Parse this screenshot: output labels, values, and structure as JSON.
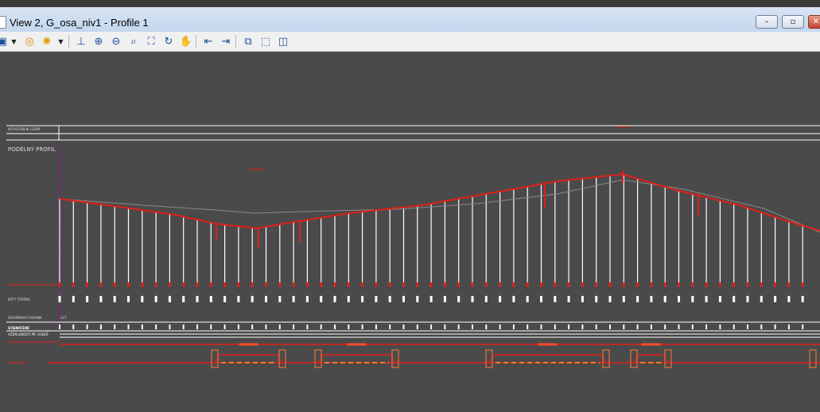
{
  "window": {
    "title": "View 2, G_osa_niv1 - Profile 1",
    "controls": {
      "minimize": "–",
      "restore": "▫",
      "close": "✕"
    }
  },
  "toolbar": {
    "icons": [
      "view-icon",
      "dropdown-arrow-icon",
      "view-attributes-icon",
      "brightness-icon",
      "dropdown-arrow-icon",
      "brush-icon",
      "zoom-in-icon",
      "zoom-out-icon",
      "zoom-area-icon",
      "fit-view-icon",
      "rotate-view-icon",
      "pan-view-icon",
      "previous-view-icon",
      "next-view-icon",
      "copy-view-icon",
      "clip-volume-icon",
      "clip-mask-icon"
    ]
  },
  "drawing": {
    "row_labels": {
      "cadastral": "KATASTRÁLNÍ ÚZEMÍ",
      "profile": "PODÉLNÝ PROFIL",
      "terrain_heights": "KÓTY TERÉNU",
      "datum": "SROVNÁVACÍ ROVINA",
      "datum_value": "227",
      "stationing": "STANIČENÍ",
      "distances": "VZDÁLENOSTI PŘ. ÚSEKŮ"
    },
    "colors": {
      "background": "#4a4a4a",
      "grade_line": "#e0201a",
      "lines": "#ffffff",
      "accent": "#ff7a3a",
      "magenta": "#c000c0"
    }
  }
}
